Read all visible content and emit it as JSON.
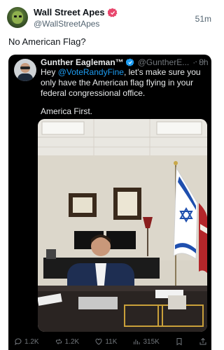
{
  "post": {
    "author_name": "Wall Street Apes",
    "author_handle": "@WallStreetApes",
    "time": "51m",
    "text": "No American Flag?"
  },
  "quoted": {
    "author_name": "Gunther Eagleman™",
    "author_handle": "@GuntherE...",
    "time": "8h",
    "text_prefix": "Hey ",
    "mention": "@VoteRandyFine",
    "text_suffix": ", let's make sure you only have the American flag flying in your federal congressional office.",
    "text2": "America First.",
    "actions": {
      "replies": "1.2K",
      "reposts": "1.2K",
      "likes": "11K",
      "views": "315K"
    }
  },
  "colors": {
    "verified_outer": "#e8466c",
    "verified_quoted": "#1d9bf0",
    "mention": "#1d9bf0",
    "card_bg": "#000000"
  },
  "icons": [
    "verified-badge-icon",
    "grok-icon",
    "more-icon",
    "reply-icon",
    "repost-icon",
    "like-icon",
    "views-icon",
    "bookmark-icon",
    "share-icon"
  ]
}
